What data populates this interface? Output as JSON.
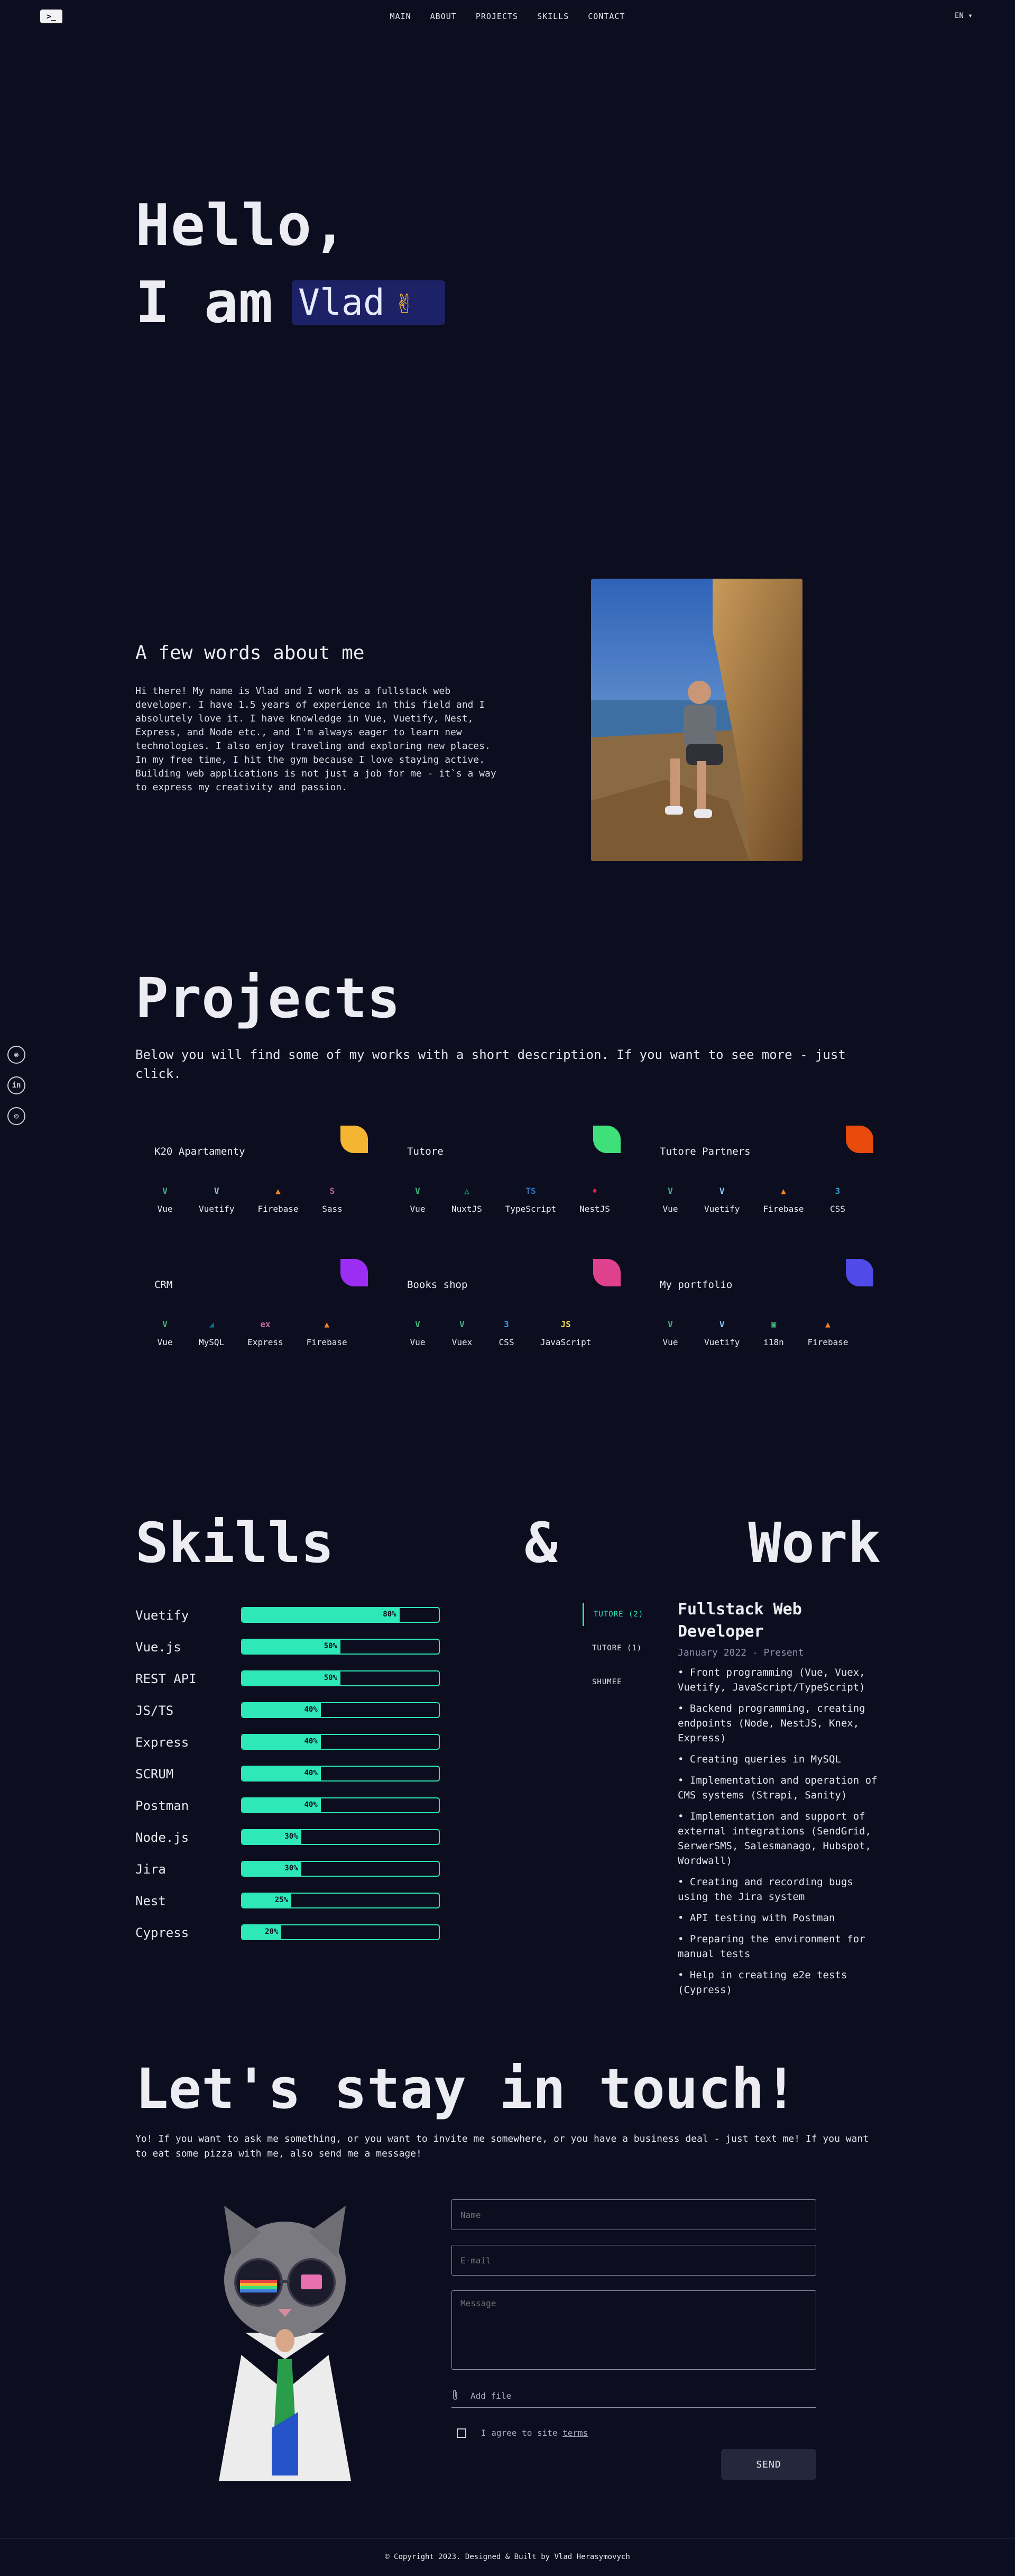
{
  "header": {
    "logo": ">_",
    "nav": [
      "MAIN",
      "ABOUT",
      "PROJECTS",
      "SKILLS",
      "CONTACT"
    ],
    "lang": "EN ▾"
  },
  "socials": [
    {
      "icon": "github-icon",
      "glyph": "◉"
    },
    {
      "icon": "linkedin-icon",
      "glyph": "in"
    },
    {
      "icon": "instagram-icon",
      "glyph": "◎"
    }
  ],
  "hero": {
    "line1": "Hello,",
    "line2": "I am",
    "name": "Vlad",
    "hand": "✌"
  },
  "about": {
    "title": "A few words about me",
    "text": "Hi there! My name is Vlad and I work as a fullstack web developer. I have 1.5 years of experience in this field and I absolutely love it. I have knowledge in Vue, Vuetify, Nest, Express, and Node etc., and I'm always eager to learn new technologies. I also enjoy traveling and exploring new places. In my free time, I hit the gym because I love staying active. Building web applications is not just a job for me - it`s a way to express my creativity and passion."
  },
  "projects": {
    "title": "Projects",
    "description": "Below you will find some of my works with a short description. If you want to see more - just click.",
    "items": [
      {
        "title": "K20 Apartamenty",
        "leaf": "#f4b533",
        "tech": [
          {
            "label": "Vue",
            "icon": "vue-icon",
            "glyph": "V",
            "color": "#41b883"
          },
          {
            "label": "Vuetify",
            "icon": "vuetify-icon",
            "glyph": "V",
            "color": "#8cc6ff"
          },
          {
            "label": "Firebase",
            "icon": "firebase-icon",
            "glyph": "▲",
            "color": "#f58220"
          },
          {
            "label": "Sass",
            "icon": "sass-icon",
            "glyph": "S",
            "color": "#cd6799"
          }
        ]
      },
      {
        "title": "Tutore",
        "leaf": "#3fe07a",
        "tech": [
          {
            "label": "Vue",
            "icon": "vue-icon",
            "glyph": "V",
            "color": "#41b883"
          },
          {
            "label": "NuxtJS",
            "icon": "nuxt-icon",
            "glyph": "△",
            "color": "#00dc82"
          },
          {
            "label": "TypeScript",
            "icon": "typescript-icon",
            "glyph": "TS",
            "color": "#3178c6"
          },
          {
            "label": "NestJS",
            "icon": "nestjs-icon",
            "glyph": "♦",
            "color": "#e0234e"
          }
        ]
      },
      {
        "title": "Tutore Partners",
        "leaf": "#e84a0c",
        "tech": [
          {
            "label": "Vue",
            "icon": "vue-icon",
            "glyph": "V",
            "color": "#41b883"
          },
          {
            "label": "Vuetify",
            "icon": "vuetify-icon",
            "glyph": "V",
            "color": "#8cc6ff"
          },
          {
            "label": "Firebase",
            "icon": "firebase-icon",
            "glyph": "▲",
            "color": "#f58220"
          },
          {
            "label": "CSS",
            "icon": "css-icon",
            "glyph": "3",
            "color": "#29a9df"
          }
        ]
      },
      {
        "title": "CRM",
        "leaf": "#9b2ef2",
        "tech": [
          {
            "label": "Vue",
            "icon": "vue-icon",
            "glyph": "V",
            "color": "#41b883"
          },
          {
            "label": "MySQL",
            "icon": "mysql-icon",
            "glyph": "◢",
            "color": "#00758f"
          },
          {
            "label": "Express",
            "icon": "express-icon",
            "glyph": "ex",
            "color": "#c36c9a"
          },
          {
            "label": "Firebase",
            "icon": "firebase-icon",
            "glyph": "▲",
            "color": "#f58220"
          }
        ]
      },
      {
        "title": "Books shop",
        "leaf": "#e0418e",
        "tech": [
          {
            "label": "Vue",
            "icon": "vue-icon",
            "glyph": "V",
            "color": "#41b883"
          },
          {
            "label": "Vuex",
            "icon": "vuex-icon",
            "glyph": "V",
            "color": "#41b883"
          },
          {
            "label": "CSS",
            "icon": "css-icon",
            "glyph": "3",
            "color": "#29a9df"
          },
          {
            "label": "JavaScript",
            "icon": "javascript-icon",
            "glyph": "JS",
            "color": "#f0db4f"
          }
        ]
      },
      {
        "title": "My portfolio",
        "leaf": "#4f4ae8",
        "tech": [
          {
            "label": "Vue",
            "icon": "vue-icon",
            "glyph": "V",
            "color": "#41b883"
          },
          {
            "label": "Vuetify",
            "icon": "vuetify-icon",
            "glyph": "V",
            "color": "#8cc6ff"
          },
          {
            "label": "i18n",
            "icon": "i18n-icon",
            "glyph": "▣",
            "color": "#3fb97a"
          },
          {
            "label": "Firebase",
            "icon": "firebase-icon",
            "glyph": "▲",
            "color": "#f58220"
          }
        ]
      }
    ]
  },
  "skills": {
    "heading": [
      "Skills",
      "&",
      "Work"
    ],
    "items": [
      {
        "name": "Vuetify",
        "percent": 80,
        "label": "80%"
      },
      {
        "name": "Vue.js",
        "percent": 50,
        "label": "50%"
      },
      {
        "name": "REST API",
        "percent": 50,
        "label": "50%"
      },
      {
        "name": "JS/TS",
        "percent": 40,
        "label": "40%"
      },
      {
        "name": "Express",
        "percent": 40,
        "label": "40%"
      },
      {
        "name": "SCRUM",
        "percent": 40,
        "label": "40%"
      },
      {
        "name": "Postman",
        "percent": 40,
        "label": "40%"
      },
      {
        "name": "Node.js",
        "percent": 30,
        "label": "30%"
      },
      {
        "name": "Jira",
        "percent": 30,
        "label": "30%"
      },
      {
        "name": "Nest",
        "percent": 25,
        "label": "25%"
      },
      {
        "name": "Cypress",
        "percent": 20,
        "label": "20%"
      }
    ]
  },
  "work": {
    "tabs": [
      "TUTORE (2)",
      "TUTORE (1)",
      "SHUMEE"
    ],
    "active_tab": 0,
    "job_title": "Fullstack Web Developer",
    "dates": "January 2022 - Present",
    "duties": [
      "• Front programming (Vue, Vuex, Vuetify, JavaScript/TypeScript)",
      "• Backend programming, creating endpoints (Node, NestJS, Knex, Express)",
      "• Creating queries in MySQL",
      "• Implementation and operation of CMS systems (Strapi, Sanity)",
      "• Implementation and support of external integrations (SendGrid, SerwerSMS, Salesmanago, Hubspot, Wordwall)",
      "• Creating and recording bugs using the Jira system",
      "• API testing with Postman",
      "• Preparing the environment for manual tests",
      "• Help in creating e2e tests (Cypress)"
    ]
  },
  "contact": {
    "title": "Let's stay in touch!",
    "description": "Yo! If you want to ask me something, or you want to invite me somewhere, or you have a business deal - just text me! If you want to eat some pizza with me, also send me a message!",
    "name_placeholder": "Name",
    "email_placeholder": "E-mail",
    "message_placeholder": "Message",
    "file_label": "Add file",
    "agree_prefix": "I agree to site",
    "terms_label": "terms",
    "send_label": "SEND"
  },
  "footer": {
    "text": "© Copyright 2023. Designed & Built by Vlad Herasymovych"
  }
}
